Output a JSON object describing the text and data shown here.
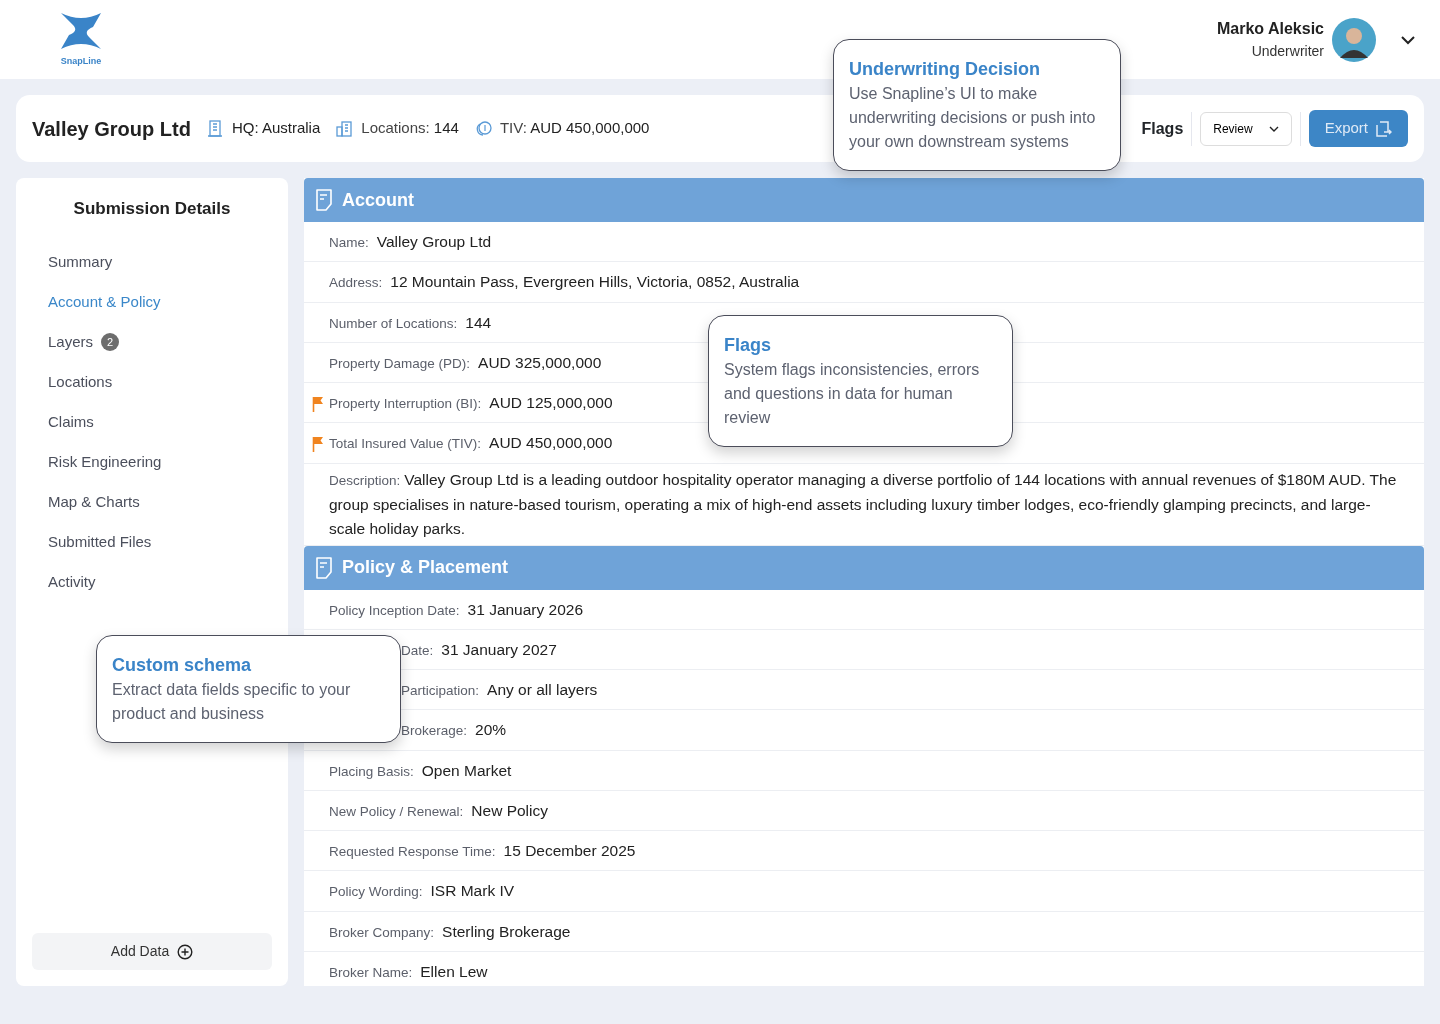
{
  "brand": {
    "name": "SnapLine"
  },
  "user": {
    "name": "Marko Aleksic",
    "role": "Underwriter"
  },
  "summary": {
    "title": "Valley Group Ltd",
    "facts": [
      {
        "kind": "hq",
        "text": "HQ: Australia"
      },
      {
        "kind": "locations",
        "label": "Locations:",
        "value": "144"
      },
      {
        "kind": "tiv",
        "label": "TIV:",
        "value": "AUD 450,000,000"
      }
    ],
    "flags": "Flags",
    "review": "Review",
    "export": "Export"
  },
  "sidebar": {
    "title": "Submission Details",
    "items": [
      {
        "label": "Summary",
        "selected": false
      },
      {
        "label": "Account & Policy",
        "selected": true
      },
      {
        "label": "Layers",
        "selected": false,
        "badge": "2"
      },
      {
        "label": "Locations",
        "selected": false
      },
      {
        "label": "Claims",
        "selected": false
      },
      {
        "label": "Risk Engineering",
        "selected": false
      },
      {
        "label": "Map & Charts",
        "selected": false
      },
      {
        "label": "Submitted Files",
        "selected": false
      },
      {
        "label": "Activity",
        "selected": false
      }
    ],
    "add_button": "Add Data"
  },
  "sections": [
    {
      "title": "Account",
      "rows": [
        {
          "label": "Name:",
          "value": "Valley Group Ltd",
          "flagged": false
        },
        {
          "label": "Address:",
          "value": "12 Mountain Pass, Evergreen Hills, Victoria, 0852, Australia",
          "flagged": false
        },
        {
          "label": "Number of Locations:",
          "value": "144",
          "flagged": false
        },
        {
          "label": "Property Damage (PD):",
          "value": "AUD 325,000,000",
          "flagged": false
        },
        {
          "label": "Property Interruption (BI):",
          "value": "AUD 125,000,000",
          "flagged": true
        },
        {
          "label": "Total Insured Value (TIV):",
          "value": "AUD 450,000,000",
          "flagged": true
        },
        {
          "label": "Description:",
          "value": "Valley Group Ltd is a leading outdoor hospitality operator managing a diverse portfolio of 144 locations with annual revenues of $180M AUD. The group specialises in nature-based tourism, operating a mix of high-end assets including luxury timber lodges, eco-friendly glamping precincts, and large-scale holiday parks.",
          "flagged": false
        }
      ]
    },
    {
      "title": "Policy & Placement",
      "rows": [
        {
          "label": "Policy Inception Date:",
          "value": "31 January 2026",
          "flagged": false
        },
        {
          "label": "Date:",
          "value": "31 January 2027",
          "flagged": false,
          "clipped": true
        },
        {
          "label": "Participation:",
          "value": "Any or all layers",
          "flagged": false,
          "clipped": true
        },
        {
          "label": "Brokerage:",
          "value": "20%",
          "flagged": false,
          "clipped": true
        },
        {
          "label": "Placing Basis:",
          "value": "Open Market",
          "flagged": false
        },
        {
          "label": "New Policy / Renewal:",
          "value": "New Policy",
          "flagged": false
        },
        {
          "label": "Requested Response Time:",
          "value": "15 December 2025",
          "flagged": false
        },
        {
          "label": "Policy Wording:",
          "value": "ISR Mark IV",
          "flagged": false
        },
        {
          "label": "Broker Company:",
          "value": "Sterling Brokerage",
          "flagged": false
        },
        {
          "label": "Broker Name:",
          "value": "Ellen Lew",
          "flagged": false
        }
      ]
    }
  ],
  "callouts": [
    {
      "kind": "decision",
      "title": "Underwriting Decision",
      "text": "Use Snapline’s UI to make underwriting decisions or push into your own downstream systems"
    },
    {
      "kind": "flags",
      "title": "Flags",
      "text": "System flags inconsistencies, errors and questions in data for human review"
    },
    {
      "kind": "schema",
      "title": "Custom schema",
      "text": "Extract data fields specific to your product and business"
    }
  ]
}
